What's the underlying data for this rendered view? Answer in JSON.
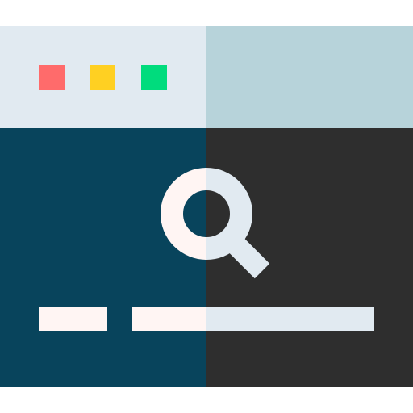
{
  "icon": {
    "name": "browser-search-icon",
    "colors": {
      "titlebar_left": "#E1EAF1",
      "titlebar_right": "#B7D3DA",
      "body_left": "#08445C",
      "body_right": "#2E2E2E",
      "close": "#FF6B6B",
      "minimize": "#FFD022",
      "maximize": "#00DC7D",
      "lens_light": "#FFF5F3",
      "lens_shade": "#E1EAF1"
    },
    "window_controls": [
      {
        "name": "close-control",
        "color": "#FF6B6B"
      },
      {
        "name": "minimize-control",
        "color": "#FFD022"
      },
      {
        "name": "maximize-control",
        "color": "#00DC7D"
      }
    ]
  }
}
